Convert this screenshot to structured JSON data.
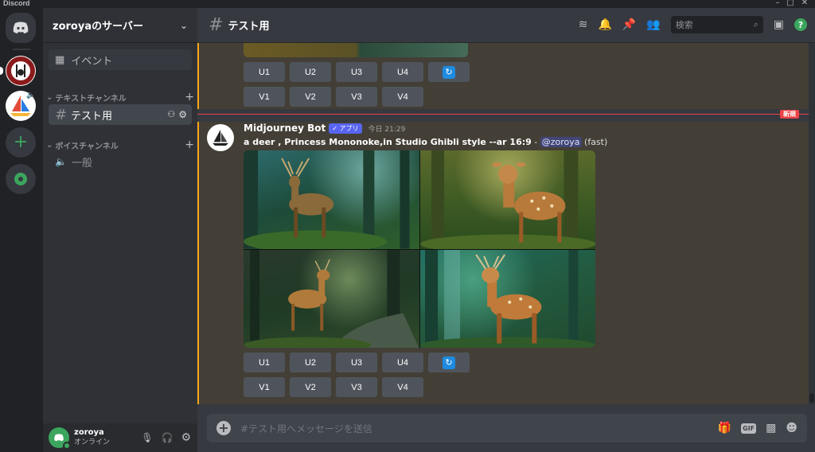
{
  "window": {
    "app_name": "Discord"
  },
  "server": {
    "name": "zoroyaのサーバー"
  },
  "sidebar": {
    "event_label": "イベント",
    "text_category": "テキストチャンネル",
    "text_channel": "テスト用",
    "voice_category": "ボイスチャンネル",
    "voice_channel": "一般"
  },
  "user": {
    "name": "zoroya",
    "status": "オンライン"
  },
  "channel_header": {
    "title": "テスト用",
    "search_placeholder": "検索"
  },
  "messages": {
    "new_divider_label": "新規",
    "previous_buttons": {
      "row1": [
        "U1",
        "U2",
        "U3",
        "U4"
      ],
      "row2": [
        "V1",
        "V2",
        "V3",
        "V4"
      ]
    },
    "bot_message": {
      "author": "Midjourney Bot",
      "app_tag": "✓ アプリ",
      "timestamp": "今日 21:29",
      "prompt": "a deer , Princess Mononoke,in Studio Ghibli style --ar 16:9",
      "separator": " - ",
      "mention": "@zoroya",
      "mode": "(fast)",
      "buttons": {
        "row1": [
          "U1",
          "U2",
          "U3",
          "U4"
        ],
        "row2": [
          "V1",
          "V2",
          "V3",
          "V4"
        ]
      }
    }
  },
  "composer": {
    "placeholder": "#テスト用へメッセージを送信"
  },
  "colors": {
    "accent": "#5865f2",
    "highlight_border": "#faa61a",
    "new_divider": "#ed4245",
    "online": "#3ba55d"
  }
}
